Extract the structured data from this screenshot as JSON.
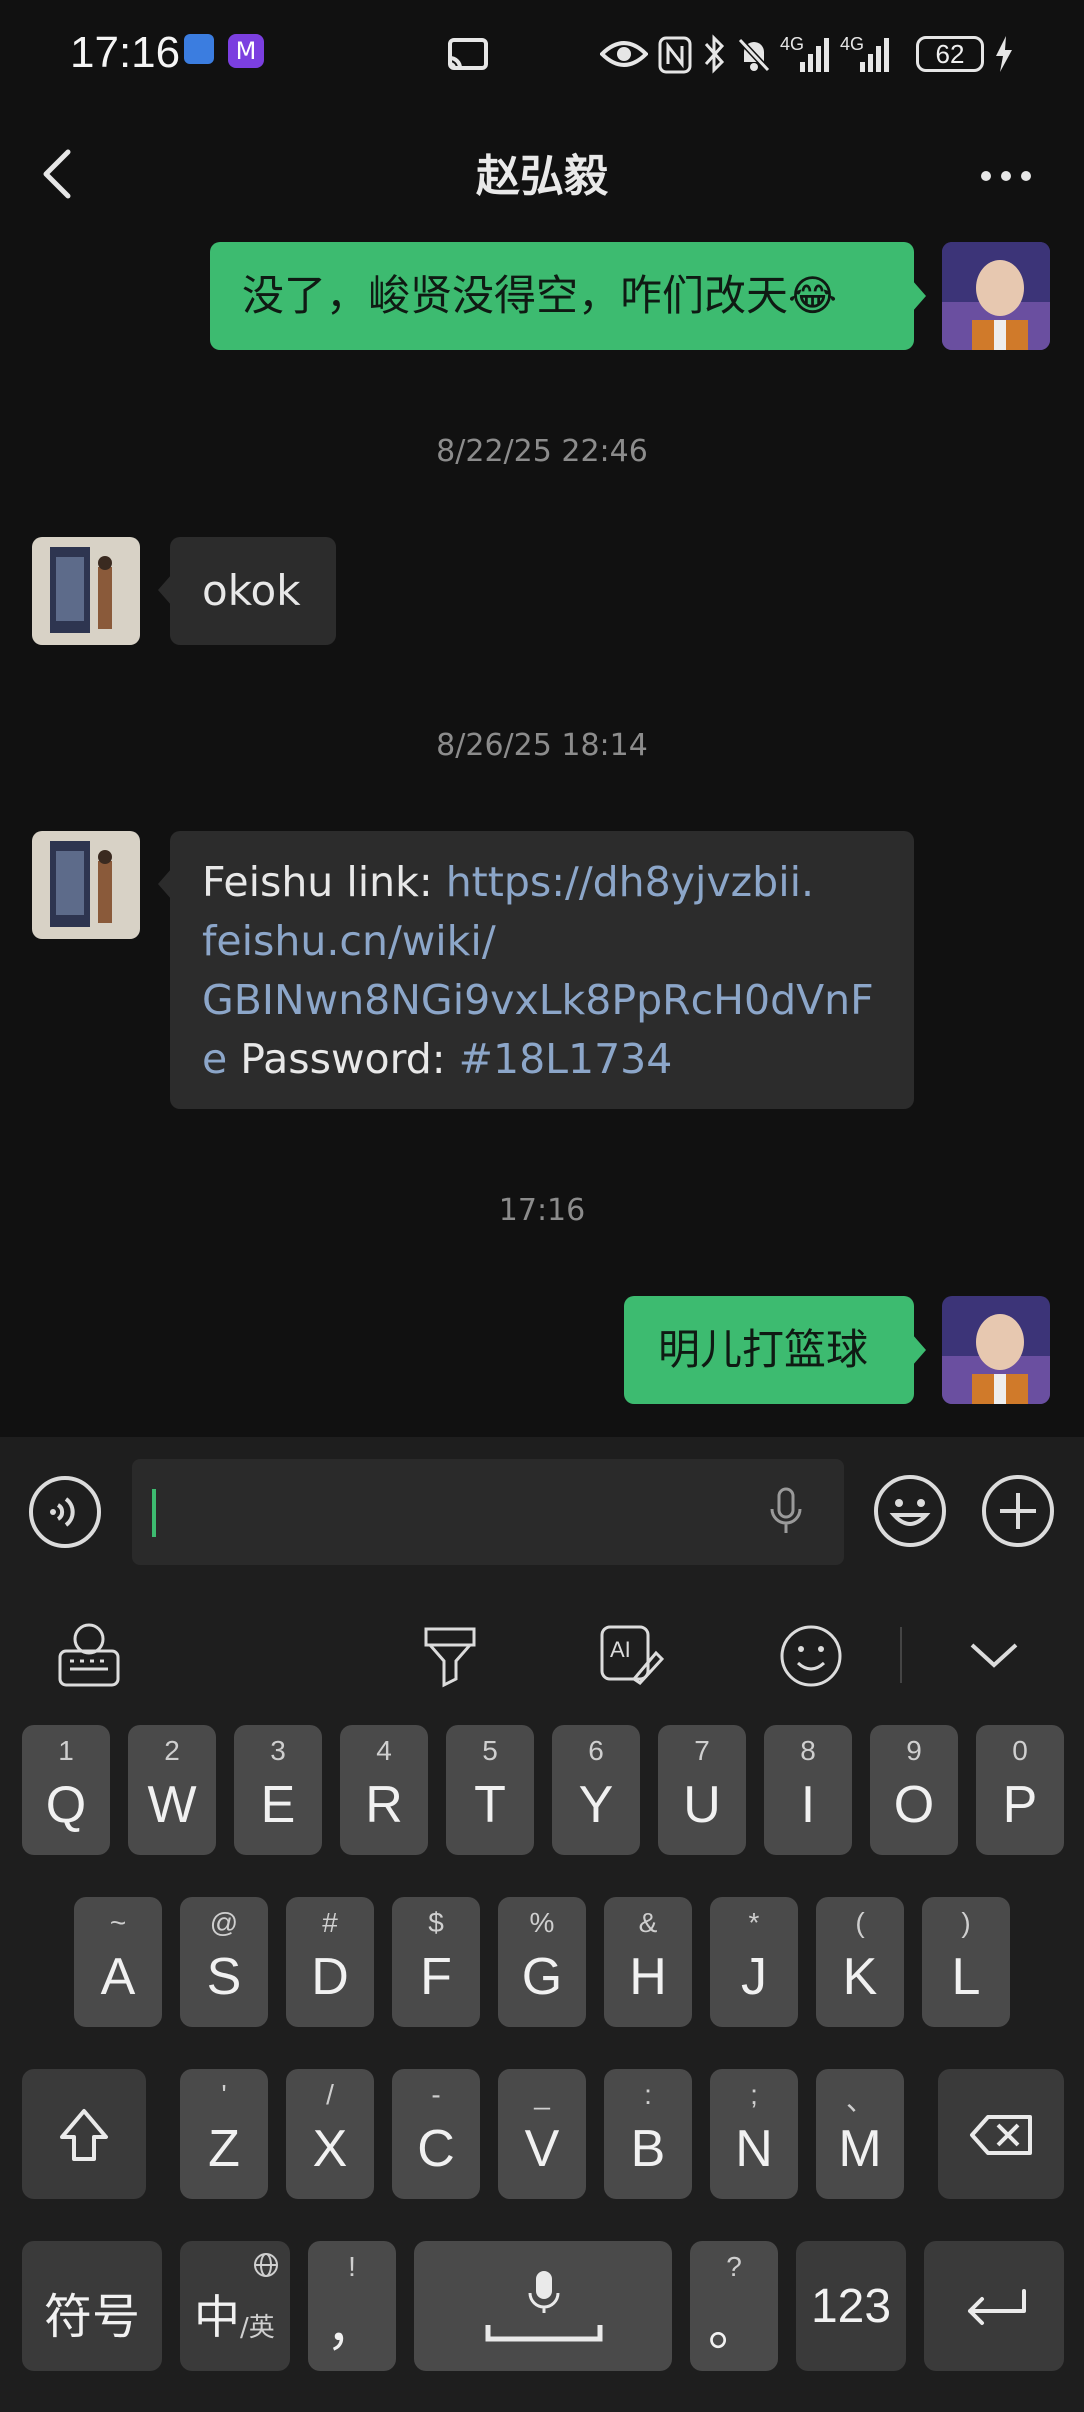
{
  "status_bar": {
    "time": "17:16",
    "network_1": "4G",
    "network_2": "4G",
    "battery": "62"
  },
  "header": {
    "title": "赵弘毅"
  },
  "messages": [
    {
      "sender": "me",
      "text": "没了，峻贤没得空，咋们改天😂"
    },
    {
      "type": "time",
      "text": "8/22/25 22:46"
    },
    {
      "sender": "other",
      "text": "okok"
    },
    {
      "type": "time",
      "text": "8/26/25 18:14"
    },
    {
      "sender": "other",
      "prefix": "Feishu link: ",
      "link_line1": "https://dh8yjvzbii.",
      "link_line2": "feishu.cn/wiki/",
      "link_line3": "GBINwn8NGi9vxLk8PpRcH0dVnF",
      "link_line4": "e",
      "password_label": " Password: ",
      "password_value": "#18L1734"
    },
    {
      "type": "time",
      "text": "17:16"
    },
    {
      "sender": "me",
      "text": "明儿打篮球"
    }
  ],
  "keyboard": {
    "row1": [
      {
        "main": "Q",
        "sub": "1"
      },
      {
        "main": "W",
        "sub": "2"
      },
      {
        "main": "E",
        "sub": "3"
      },
      {
        "main": "R",
        "sub": "4"
      },
      {
        "main": "T",
        "sub": "5"
      },
      {
        "main": "Y",
        "sub": "6"
      },
      {
        "main": "U",
        "sub": "7"
      },
      {
        "main": "I",
        "sub": "8"
      },
      {
        "main": "O",
        "sub": "9"
      },
      {
        "main": "P",
        "sub": "0"
      }
    ],
    "row2": [
      {
        "main": "A",
        "sub": "~"
      },
      {
        "main": "S",
        "sub": "@"
      },
      {
        "main": "D",
        "sub": "#"
      },
      {
        "main": "F",
        "sub": "$"
      },
      {
        "main": "G",
        "sub": "%"
      },
      {
        "main": "H",
        "sub": "&"
      },
      {
        "main": "J",
        "sub": "*"
      },
      {
        "main": "K",
        "sub": "("
      },
      {
        "main": "L",
        "sub": ")"
      }
    ],
    "row3": [
      {
        "main": "Z",
        "sub": "'"
      },
      {
        "main": "X",
        "sub": "/"
      },
      {
        "main": "C",
        "sub": "-"
      },
      {
        "main": "V",
        "sub": "_"
      },
      {
        "main": "B",
        "sub": ":"
      },
      {
        "main": "N",
        "sub": ";"
      },
      {
        "main": "M",
        "sub": "、"
      }
    ],
    "symbols_label": "符号",
    "lang_main": "中",
    "lang_sub": "/英",
    "comma_main": "，",
    "comma_sub": "!",
    "period_main": "。",
    "period_sub": "?",
    "numbers_label": "123"
  },
  "colors": {
    "sent_bubble": "#3dbb70",
    "received_bubble": "#2c2c2c",
    "link": "#8ca6c9",
    "background": "#111111"
  }
}
